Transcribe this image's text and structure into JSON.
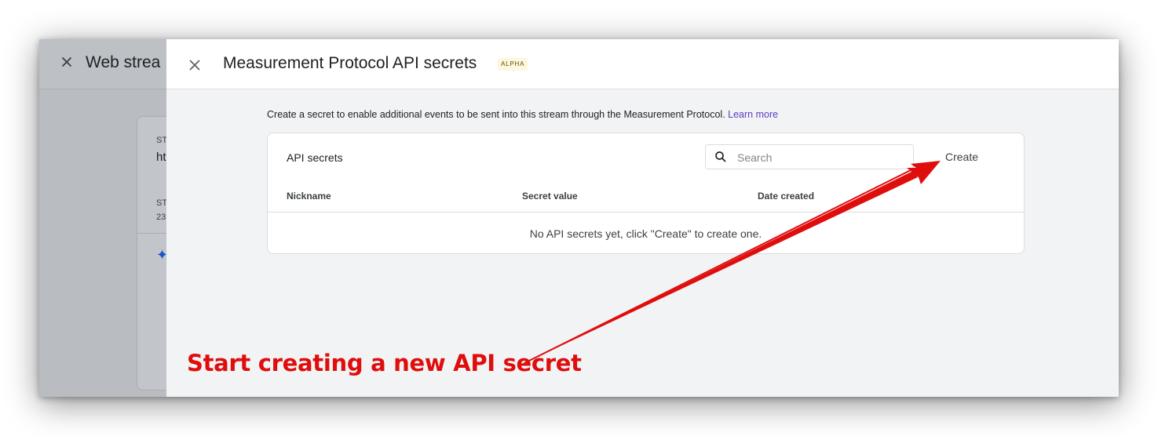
{
  "background": {
    "title": "Web strea",
    "card": {
      "label1": "ST",
      "value1": "ht",
      "label2": "ST",
      "value2": "23"
    },
    "sparkle_icon": "sparkle-icon"
  },
  "panel": {
    "title": "Measurement Protocol API secrets",
    "badge": "ALPHA",
    "close_icon": "close-icon",
    "intro_text": "Create a secret to enable additional events to be sent into this stream through the Measurement Protocol.",
    "learn_more": "Learn more",
    "table": {
      "title": "API secrets",
      "search_placeholder": "Search",
      "create_label": "Create",
      "columns": [
        "Nickname",
        "Secret value",
        "Date created"
      ],
      "empty_message": "No API secrets yet, click \"Create\" to create one."
    }
  },
  "annotation": {
    "text": "Start creating a new API secret",
    "color": "#e00d0d"
  },
  "colors": {
    "link": "#5b3cc4",
    "badge_bg": "#fef7e0",
    "panel_bg": "#f1f3f4"
  }
}
